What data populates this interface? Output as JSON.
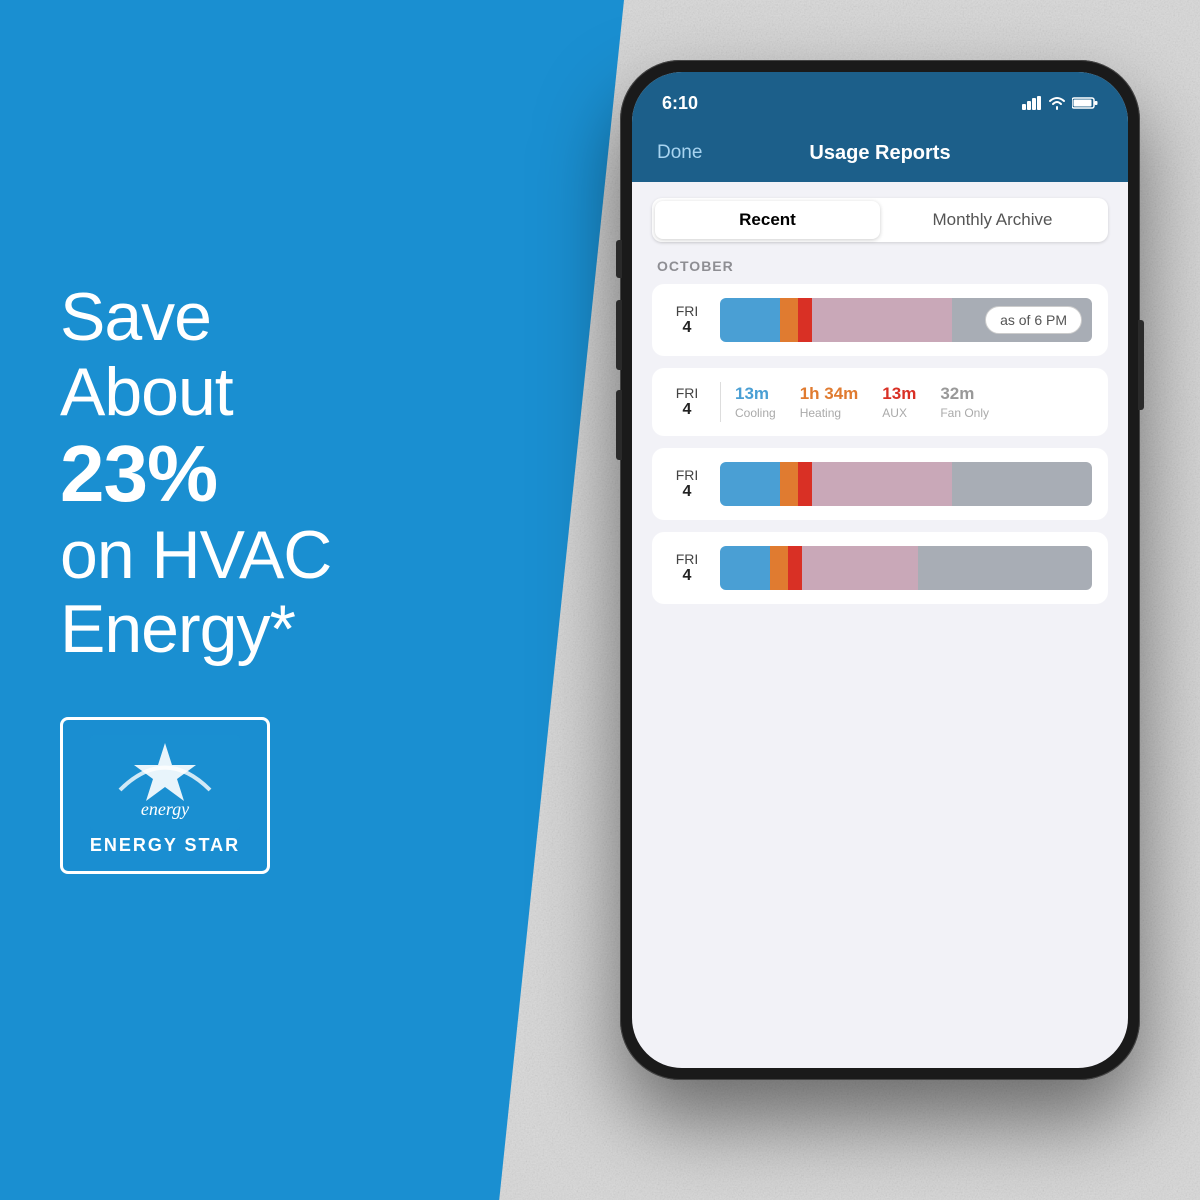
{
  "background": {
    "left_color": "#1a8fd1",
    "right_color": "#d0d0d0"
  },
  "left_panel": {
    "line1": "Save",
    "line2": "About",
    "line3_normal": "",
    "line3_bold": "23%",
    "line4": "on HVAC",
    "line5": "Energy*",
    "energy_star_label": "ENERGY STAR"
  },
  "phone": {
    "status_bar": {
      "time": "6:10"
    },
    "nav": {
      "done_label": "Done",
      "title": "Usage Reports"
    },
    "segment": {
      "active_label": "Recent",
      "inactive_label": "Monthly Archive"
    },
    "section_header": "OCTOBER",
    "rows": [
      {
        "day_name": "FRI",
        "day_num": "4",
        "type": "bar",
        "has_badge": true,
        "badge_text": "as of 6 PM"
      },
      {
        "day_name": "FRI",
        "day_num": "4",
        "type": "stats",
        "stats": [
          {
            "value": "13m",
            "label": "Cooling",
            "color": "blue"
          },
          {
            "value": "1h 34m",
            "label": "Heating",
            "color": "orange"
          },
          {
            "value": "13m",
            "label": "AUX",
            "color": "red"
          },
          {
            "value": "32m",
            "label": "Fan Only",
            "color": "gray"
          }
        ]
      },
      {
        "day_name": "FRI",
        "day_num": "4",
        "type": "bar",
        "has_badge": false
      },
      {
        "day_name": "FRI",
        "day_num": "4",
        "type": "bar",
        "has_badge": false
      }
    ]
  }
}
